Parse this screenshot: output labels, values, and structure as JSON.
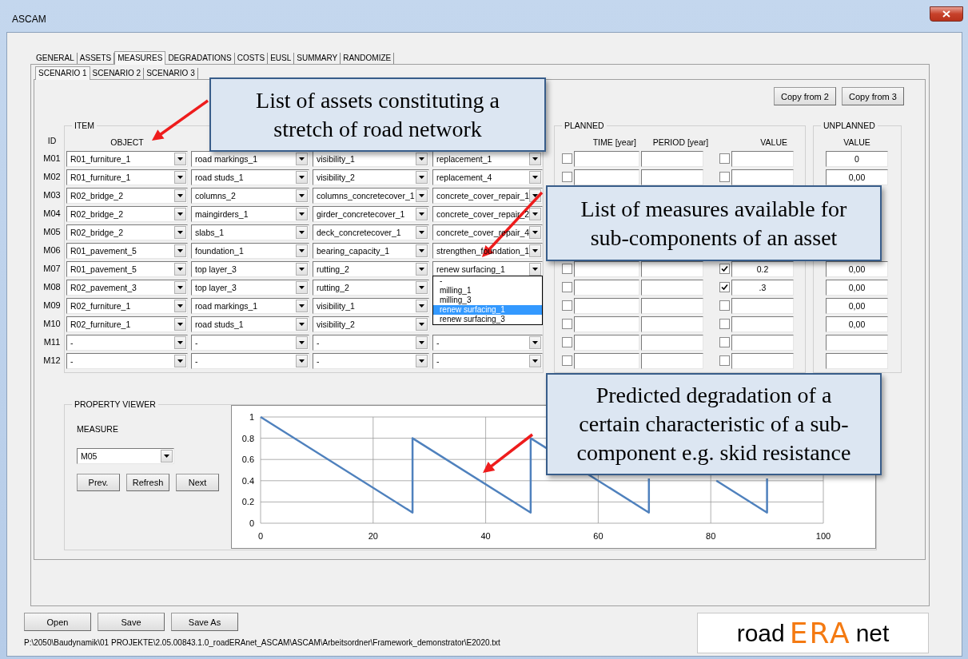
{
  "window": {
    "title": "ASCAM"
  },
  "tabs": [
    {
      "label": "GENERAL",
      "selected": false
    },
    {
      "label": "ASSETS",
      "selected": false
    },
    {
      "label": "MEASURES",
      "selected": true
    },
    {
      "label": "DEGRADATIONS",
      "selected": false
    },
    {
      "label": "COSTS",
      "selected": false
    },
    {
      "label": "EUSL",
      "selected": false
    },
    {
      "label": "SUMMARY",
      "selected": false
    },
    {
      "label": "RANDOMIZE",
      "selected": false
    }
  ],
  "subtabs": [
    {
      "label": "SCENARIO 1",
      "selected": true
    },
    {
      "label": "SCENARIO 2",
      "selected": false
    },
    {
      "label": "SCENARIO 3",
      "selected": false
    }
  ],
  "copy_buttons": [
    "Copy from 2",
    "Copy from 3"
  ],
  "item": {
    "legend": "ITEM",
    "id_header": "ID",
    "headers": [
      "OBJECT"
    ]
  },
  "planned": {
    "legend": "PLANNED",
    "headers": [
      "TIME [year]",
      "PERIOD [year]",
      "VALUE"
    ]
  },
  "unplanned": {
    "legend": "UNPLANNED",
    "header": "VALUE"
  },
  "rows": [
    {
      "id": "M01",
      "object": "R01_furniture_1",
      "component": "road markings_1",
      "characteristic": "visibility_1",
      "measure": "replacement_1",
      "planned": {
        "time_checked": false,
        "value_checked": false
      },
      "unplanned": "0"
    },
    {
      "id": "M02",
      "object": "R01_furniture_1",
      "component": "road studs_1",
      "characteristic": "visibility_2",
      "measure": "replacement_4",
      "planned": {
        "time_checked": false,
        "value_checked": false
      },
      "unplanned": "0,00"
    },
    {
      "id": "M03",
      "object": "R02_bridge_2",
      "component": "columns_2",
      "characteristic": "columns_concretecover_1",
      "measure": "concrete_cover_repair_1"
    },
    {
      "id": "M04",
      "object": "R02_bridge_2",
      "component": "maingirders_1",
      "characteristic": "girder_concretecover_1",
      "measure": "concrete_cover_repair_2"
    },
    {
      "id": "M05",
      "object": "R02_bridge_2",
      "component": "slabs_1",
      "characteristic": "deck_concretecover_1",
      "measure": "concrete_cover_repair_4"
    },
    {
      "id": "M06",
      "object": "R01_pavement_5",
      "component": "foundation_1",
      "characteristic": "bearing_capacity_1",
      "measure": "strengthen_foundation_1"
    },
    {
      "id": "M07",
      "object": "R01_pavement_5",
      "component": "top layer_3",
      "characteristic": "rutting_2",
      "measure": "renew surfacing_1",
      "planned": {
        "time_checked": false,
        "value_checked": true,
        "value": "0.2"
      },
      "unplanned": "0,00"
    },
    {
      "id": "M08",
      "object": "R02_pavement_3",
      "component": "top layer_3",
      "characteristic": "rutting_2",
      "planned": {
        "time_checked": false,
        "value_checked": true,
        "value": ".3"
      },
      "unplanned": "0,00"
    },
    {
      "id": "M09",
      "object": "R02_furniture_1",
      "component": "road markings_1",
      "characteristic": "visibility_1",
      "planned": {
        "time_checked": false,
        "value_checked": false
      },
      "unplanned": "0,00"
    },
    {
      "id": "M10",
      "object": "R02_furniture_1",
      "component": "road studs_1",
      "characteristic": "visibility_2",
      "planned": {
        "time_checked": false,
        "value_checked": false
      },
      "unplanned": "0,00"
    },
    {
      "id": "M11",
      "object": "-",
      "component": "-",
      "characteristic": "-",
      "measure": "-",
      "planned": {
        "time_checked": false,
        "value_checked": false
      }
    },
    {
      "id": "M12",
      "object": "-",
      "component": "-",
      "characteristic": "-",
      "measure": "-",
      "planned": {
        "time_checked": false,
        "value_checked": false
      }
    }
  ],
  "dropdown_list": {
    "options": [
      {
        "label": "-",
        "selected": false
      },
      {
        "label": "milling_1",
        "selected": false
      },
      {
        "label": "milling_3",
        "selected": false
      },
      {
        "label": "renew surfacing_1",
        "selected": true
      },
      {
        "label": "renew surfacing_3",
        "selected": false
      }
    ]
  },
  "property_viewer": {
    "legend": "PROPERTY VIEWER",
    "measure_label": "MEASURE",
    "measure": "M05",
    "buttons": [
      "Prev.",
      "Refresh",
      "Next"
    ],
    "chart_data": {
      "type": "line",
      "x": [
        0,
        27,
        27,
        48,
        48,
        69,
        69,
        81,
        90,
        90
      ],
      "series": [
        {
          "color": "#4f81bd",
          "values": [
            1,
            0.1,
            0.8,
            0.1,
            0.8,
            0.1,
            0.42,
            null,
            null,
            null
          ]
        },
        {
          "color": "#4f81bd",
          "values": [
            null,
            null,
            null,
            null,
            null,
            null,
            null,
            0.4,
            0.1,
            0.42
          ]
        }
      ],
      "xlim": [
        0,
        100
      ],
      "ylim": [
        0,
        1
      ],
      "xticks": [
        0,
        20,
        40,
        60,
        80,
        100
      ],
      "yticks": [
        0,
        0.2,
        0.4,
        0.6,
        0.8,
        1
      ],
      "grid": true
    }
  },
  "file_buttons": [
    "Open",
    "Save",
    "Save As"
  ],
  "path": "P:\\2050\\Baudynamik\\01 PROJEKTE\\2.05.00843.1.0_roadERAnet_ASCAM\\ASCAM\\Arbeitsordner\\Framework_demonstrator\\E2020.txt",
  "logo": [
    "road",
    "ERA",
    "net"
  ],
  "callouts": [
    {
      "lines": [
        "List of assets constituting a",
        "stretch of road network"
      ]
    },
    {
      "lines": [
        "List of measures available for",
        "sub-components of an asset"
      ]
    },
    {
      "lines": [
        "Predicted degradation of a",
        "certain characteristic of a sub-",
        "component e.g. skid resistance"
      ]
    }
  ]
}
